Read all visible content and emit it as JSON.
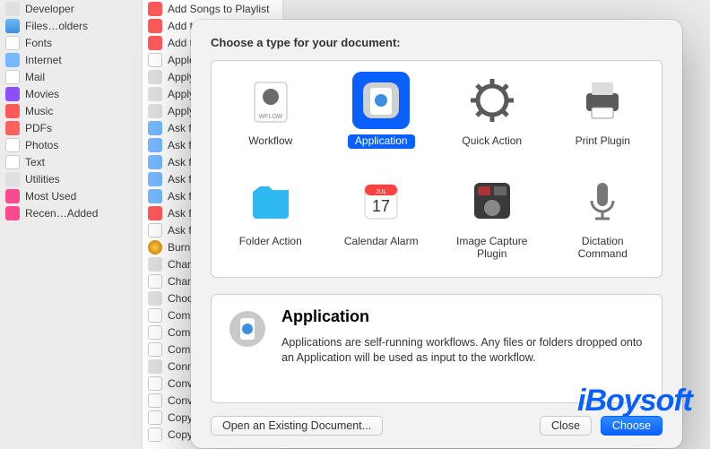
{
  "sidebar1": {
    "items": [
      {
        "label": "Developer",
        "icon": "gear"
      },
      {
        "label": "Files…olders",
        "icon": "folder"
      },
      {
        "label": "Fonts",
        "icon": "doc"
      },
      {
        "label": "Internet",
        "icon": "globe"
      },
      {
        "label": "Mail",
        "icon": "doc"
      },
      {
        "label": "Movies",
        "icon": "purple"
      },
      {
        "label": "Music",
        "icon": "music"
      },
      {
        "label": "PDFs",
        "icon": "pdf"
      },
      {
        "label": "Photos",
        "icon": "doc"
      },
      {
        "label": "Text",
        "icon": "doc"
      },
      {
        "label": "Utilities",
        "icon": "gear"
      },
      {
        "label": "Most Used",
        "icon": "pink"
      },
      {
        "label": "Recen…Added",
        "icon": "pink"
      }
    ]
  },
  "sidebar2": {
    "items": [
      {
        "label": "Add Songs to Playlist",
        "icon": "music"
      },
      {
        "label": "Add t…",
        "icon": "music"
      },
      {
        "label": "Add t…",
        "icon": "music"
      },
      {
        "label": "Apple…",
        "icon": "doc"
      },
      {
        "label": "Apply…",
        "icon": "gear"
      },
      {
        "label": "Apply…",
        "icon": "gear"
      },
      {
        "label": "Apply…",
        "icon": "gear"
      },
      {
        "label": "Ask f…",
        "icon": "globe"
      },
      {
        "label": "Ask f…",
        "icon": "globe"
      },
      {
        "label": "Ask f…",
        "icon": "globe"
      },
      {
        "label": "Ask f…",
        "icon": "globe"
      },
      {
        "label": "Ask f…",
        "icon": "globe"
      },
      {
        "label": "Ask f…",
        "icon": "music"
      },
      {
        "label": "Ask f…",
        "icon": "doc"
      },
      {
        "label": "Burn …",
        "icon": "burn"
      },
      {
        "label": "Chan…",
        "icon": "gear"
      },
      {
        "label": "Chan…",
        "icon": "doc"
      },
      {
        "label": "Choo…",
        "icon": "gear"
      },
      {
        "label": "Comb…",
        "icon": "doc"
      },
      {
        "label": "Comb…",
        "icon": "doc"
      },
      {
        "label": "Comp…",
        "icon": "doc"
      },
      {
        "label": "Conn…",
        "icon": "gear"
      },
      {
        "label": "Conv…",
        "icon": "doc"
      },
      {
        "label": "Conv…",
        "icon": "doc"
      },
      {
        "label": "Copy…",
        "icon": "doc"
      },
      {
        "label": "Copy…",
        "icon": "doc"
      }
    ]
  },
  "sheet": {
    "title": "Choose a type for your document:",
    "types": [
      {
        "label": "Workflow",
        "selected": false
      },
      {
        "label": "Application",
        "selected": true
      },
      {
        "label": "Quick Action",
        "selected": false
      },
      {
        "label": "Print Plugin",
        "selected": false
      },
      {
        "label": "Folder Action",
        "selected": false
      },
      {
        "label": "Calendar Alarm",
        "selected": false
      },
      {
        "label": "Image Capture Plugin",
        "selected": false
      },
      {
        "label": "Dictation Command",
        "selected": false
      }
    ],
    "desc": {
      "heading": "Application",
      "body": "Applications are self-running workflows. Any files or folders dropped onto an Application will be used as input to the workflow."
    },
    "buttons": {
      "open": "Open an Existing Document...",
      "close": "Close",
      "choose": "Choose"
    }
  },
  "watermark": "iBoysoft"
}
